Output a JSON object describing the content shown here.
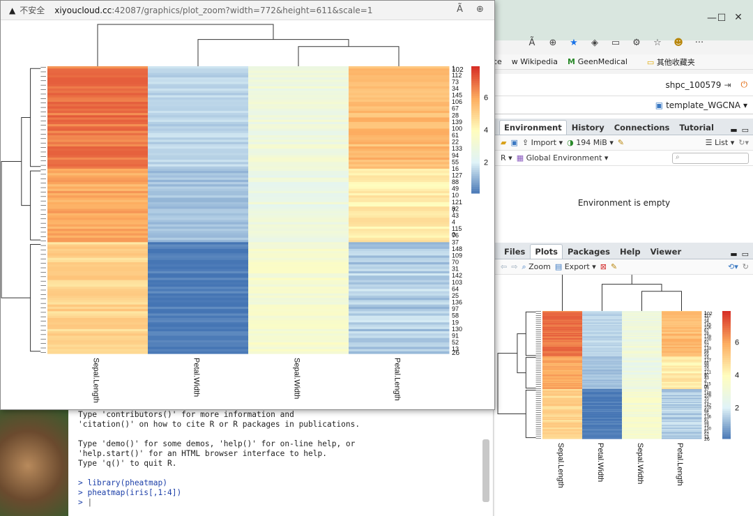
{
  "popup": {
    "security_label": "不安全",
    "url_host": "xiyoucloud.cc",
    "url_path": ":42087/graphics/plot_zoom?width=772&height=611&scale=1"
  },
  "browser": {
    "bookmarks": [
      {
        "label": "nce",
        "icon": "link-icon"
      },
      {
        "label": "Wikipedia",
        "icon": "wikipedia-icon"
      },
      {
        "label": "GeenMedical",
        "icon": "geenmedical-icon"
      },
      {
        "label": "其他收藏夹",
        "icon": "folder-icon"
      }
    ]
  },
  "rstudio": {
    "user": "shpc_100579",
    "project": "template_WGCNA",
    "env_tabs": [
      "Environment",
      "History",
      "Connections",
      "Tutorial"
    ],
    "env_toolbar": {
      "import": "Import",
      "memory": "194 MiB",
      "list": "List"
    },
    "env_scope": {
      "language": "R",
      "env": "Global Environment"
    },
    "env_empty": "Environment is empty",
    "files_tabs": [
      "Files",
      "Plots",
      "Packages",
      "Help",
      "Viewer"
    ],
    "plots_toolbar": {
      "zoom": "Zoom",
      "export": "Export"
    }
  },
  "console": {
    "lines": [
      "Type 'contributors()' for more information and",
      "'citation()' on how to cite R or R packages in publications.",
      "",
      "Type 'demo()' for some demos, 'help()' for on-line help, or",
      "'help.start()' for an HTML browser interface to help.",
      "Type 'q()' to quit R.",
      ""
    ],
    "commands": [
      "> library(pheatmap)",
      "> pheatmap(iris[,1:4])",
      "> "
    ]
  },
  "chart_data": {
    "type": "heatmap",
    "columns": [
      "Sepal.Length",
      "Petal.Width",
      "Sepal.Width",
      "Petal.Length"
    ],
    "legend_ticks": [
      2,
      4,
      6
    ],
    "color_range": [
      0.1,
      7.9
    ],
    "palette": [
      "#4575b4",
      "#e0f3f8",
      "#fffdbe",
      "#fdae61",
      "#d73027"
    ],
    "blocks": [
      {
        "rows": 46,
        "values": [
          6.8,
          1.6,
          3.0,
          5.6
        ]
      },
      {
        "rows": 33,
        "values": [
          5.9,
          1.3,
          2.8,
          4.4
        ]
      },
      {
        "rows": 50,
        "values": [
          5.0,
          0.25,
          3.4,
          1.5
        ]
      }
    ],
    "row_labels_visible": [
      "102",
      "7",
      "0",
      "26"
    ]
  }
}
